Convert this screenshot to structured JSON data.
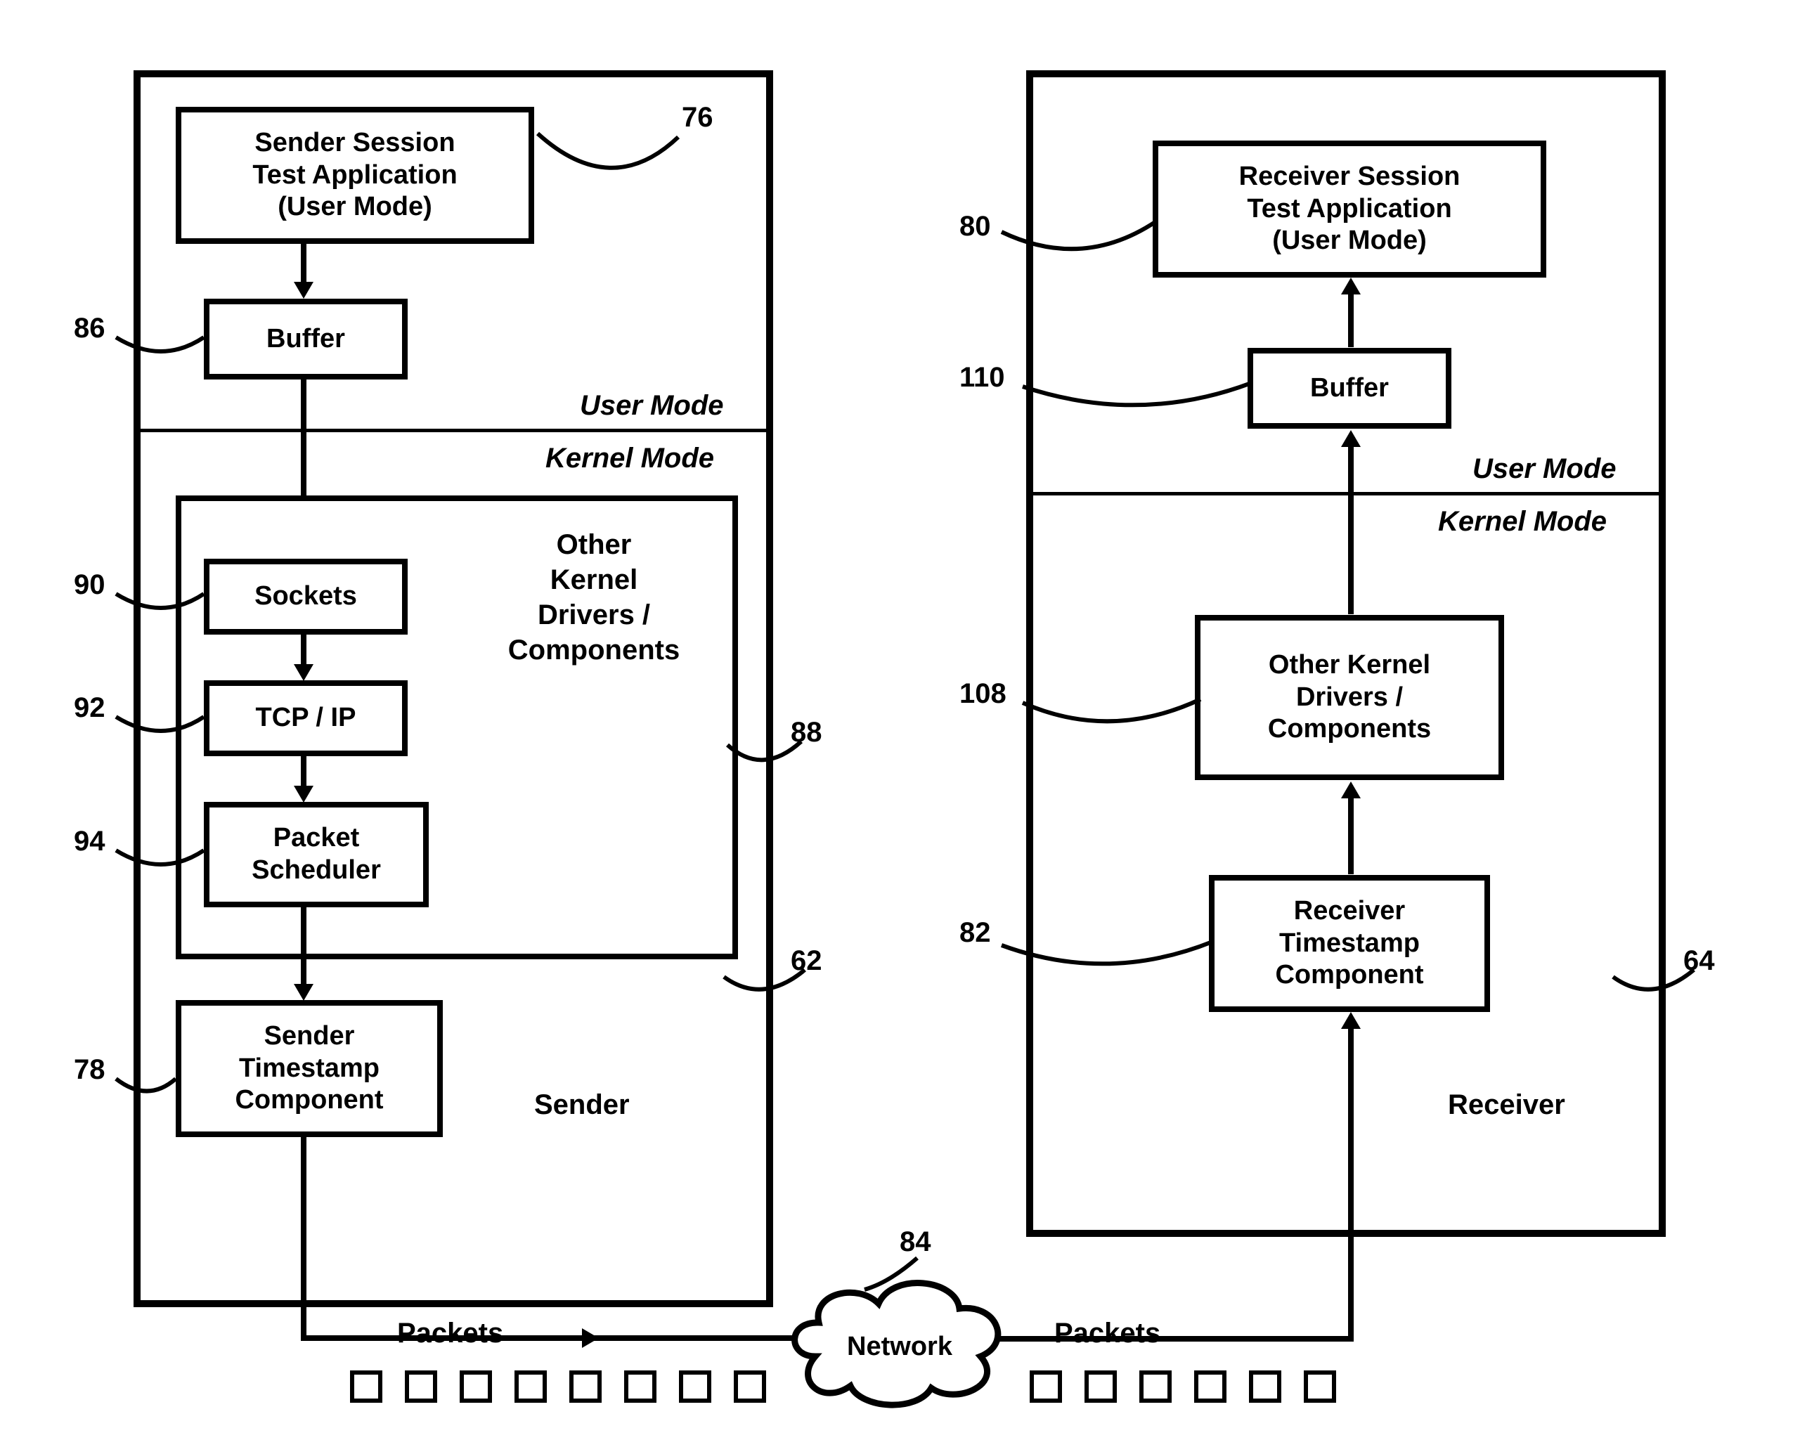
{
  "sender": {
    "title": "Sender",
    "app": "Sender Session\nTest Application\n(User Mode)",
    "buffer": "Buffer",
    "userMode": "User Mode",
    "kernelMode": "Kernel Mode",
    "otherKernel": "Other\nKernel\nDrivers /\nComponents",
    "sockets": "Sockets",
    "tcpip": "TCP / IP",
    "packetScheduler": "Packet\nScheduler",
    "timestamp": "Sender\nTimestamp\nComponent"
  },
  "receiver": {
    "title": "Receiver",
    "app": "Receiver Session\nTest Application\n(User Mode)",
    "buffer": "Buffer",
    "userMode": "User Mode",
    "kernelMode": "Kernel Mode",
    "otherKernel": "Other Kernel\nDrivers /\nComponents",
    "timestamp": "Receiver\nTimestamp\nComponent"
  },
  "network": {
    "label": "Network",
    "packetsLeft": "Packets",
    "packetsRight": "Packets"
  },
  "refs": {
    "r76": "76",
    "r86": "86",
    "r90": "90",
    "r92": "92",
    "r94": "94",
    "r78": "78",
    "r88": "88",
    "r62": "62",
    "r80": "80",
    "r110": "110",
    "r108": "108",
    "r82": "82",
    "r64": "64",
    "r84": "84"
  }
}
